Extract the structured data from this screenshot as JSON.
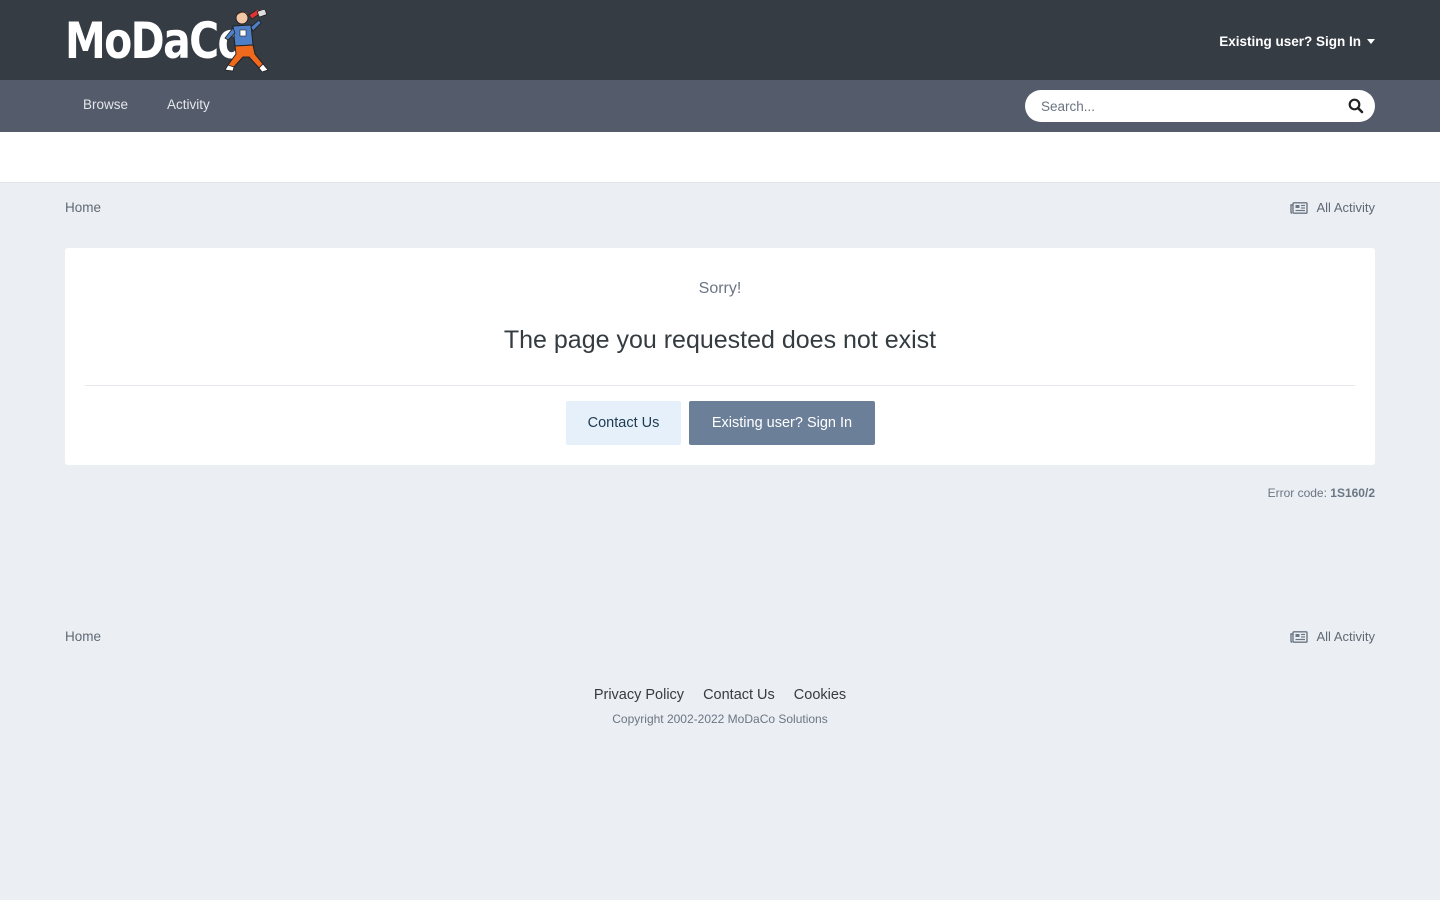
{
  "header": {
    "logo_text": "MoDaCo",
    "user_link": "Existing user? Sign In"
  },
  "nav": {
    "items": [
      {
        "label": "Browse"
      },
      {
        "label": "Activity"
      }
    ],
    "search_placeholder": "Search..."
  },
  "breadcrumb": {
    "home": "Home",
    "all_activity": "All Activity"
  },
  "error": {
    "sorry": "Sorry!",
    "title": "The page you requested does not exist",
    "contact_button": "Contact Us",
    "signin_button": "Existing user? Sign In",
    "code_label": "Error code:",
    "code_value": "1S160/2"
  },
  "footer": {
    "links": [
      {
        "label": "Privacy Policy"
      },
      {
        "label": "Contact Us"
      },
      {
        "label": "Cookies"
      }
    ],
    "copyright": "Copyright 2002-2022 MoDaCo Solutions"
  },
  "colors": {
    "header_bg": "#353c44",
    "nav_bg": "#545c6c",
    "page_bg": "#ebeef2",
    "primary_button": "#6c7f99",
    "light_button": "#e5f0fa"
  }
}
